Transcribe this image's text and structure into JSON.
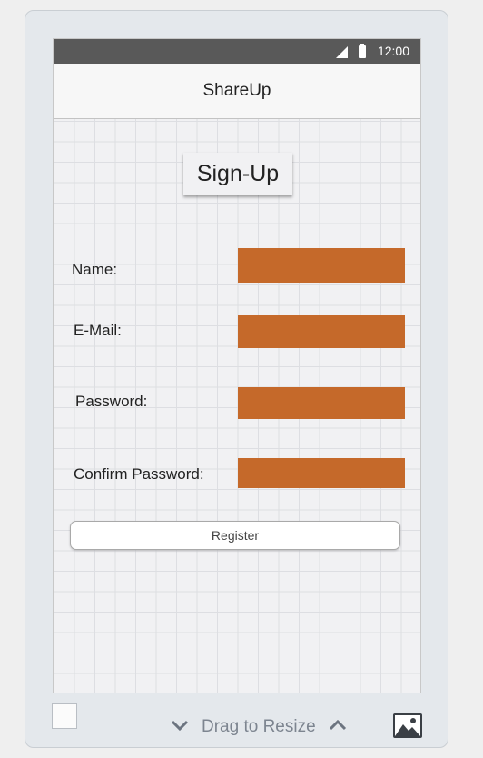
{
  "statusbar": {
    "time": "12:00"
  },
  "app": {
    "title": "ShareUp"
  },
  "form": {
    "heading": "Sign-Up",
    "name_label": "Name:",
    "email_label": "E-Mail:",
    "password_label": "Password:",
    "confirm_label": "Confirm Password:",
    "name_value": "",
    "email_value": "",
    "password_value": "",
    "confirm_value": "",
    "field_color": "#c5692a",
    "register_label": "Register"
  },
  "footer": {
    "resize_label": "Drag to Resize"
  },
  "icons": [
    "signal-icon",
    "battery-icon",
    "chevron-down-icon",
    "chevron-up-icon",
    "image-icon"
  ]
}
